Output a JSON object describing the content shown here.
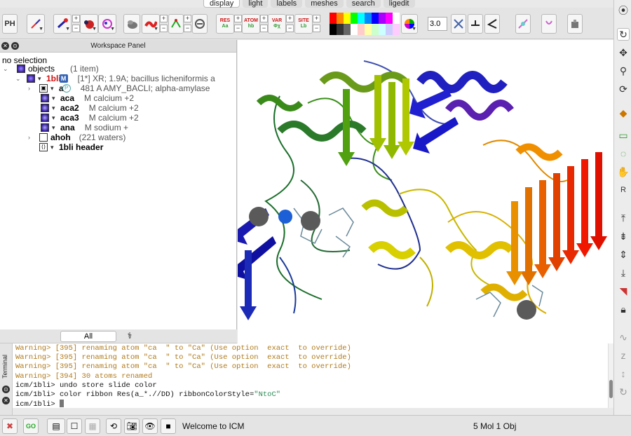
{
  "tabs": [
    "display",
    "light",
    "labels",
    "meshes",
    "search",
    "ligedit"
  ],
  "toolbar": {
    "ph_label": "PH",
    "res_label": "RES",
    "atom_label": "ATOM",
    "var_label": "VAR",
    "site_label": "SITE",
    "thickness_value": "3.0",
    "palette_colors": [
      "#ff0000",
      "#ff8800",
      "#ffff00",
      "#00ff00",
      "#00ffff",
      "#0088ff",
      "#0000ff",
      "#aa00ff",
      "#ff00ff",
      "#ffffff",
      "#000000",
      "#333333",
      "#666666",
      "#ffffff",
      "#ffcccc",
      "#ffffaa",
      "#ccffcc",
      "#ccffff",
      "#ccccff",
      "#ffccff"
    ]
  },
  "workspace": {
    "title": "Workspace Panel",
    "selection": "no selection",
    "rows": [
      {
        "name": "objects",
        "desc": "(1 item)"
      },
      {
        "name": "1bli",
        "desc": "[1*] XR; 1.9A; bacillus licheniformis a"
      },
      {
        "name": "a",
        "desc": "481 A AMY_BACLI; alpha-amylase"
      },
      {
        "name": "aca",
        "desc": "M calcium +2"
      },
      {
        "name": "aca2",
        "desc": "M calcium +2"
      },
      {
        "name": "aca3",
        "desc": "M calcium +2"
      },
      {
        "name": "ana",
        "desc": "M sodium +"
      },
      {
        "name": "ahoh",
        "desc": "(221 waters)"
      },
      {
        "name": "1bli header",
        "desc": ""
      }
    ],
    "tab_all": "All"
  },
  "terminal": {
    "label": "Terminal",
    "lines": [
      {
        "kind": "warn",
        "text": "Warning> [395] renaming atom \"ca  \" to \"Ca\" (Use option  exact  to override)"
      },
      {
        "kind": "warn",
        "text": "Warning> [395] renaming atom \"ca  \" to \"Ca\" (Use option  exact  to override)"
      },
      {
        "kind": "warn",
        "text": "Warning> [395] renaming atom \"ca  \" to \"Ca\" (Use option  exact  to override)"
      },
      {
        "kind": "warn",
        "text": "Warning> [394] 30 atoms renamed"
      },
      {
        "kind": "plain",
        "text": "icm/1bli> undo store slide color"
      },
      {
        "kind": "plain",
        "text": "icm/1bli> color ribbon Res(a_*.//DD) ribbonColorStyle=",
        "str": "\"NtoC\""
      },
      {
        "kind": "plain",
        "text": "icm/1bli> "
      }
    ]
  },
  "status": {
    "welcome": "Welcome to ICM",
    "counts": "5 Mol 1 Obj",
    "go_label": "GO"
  }
}
